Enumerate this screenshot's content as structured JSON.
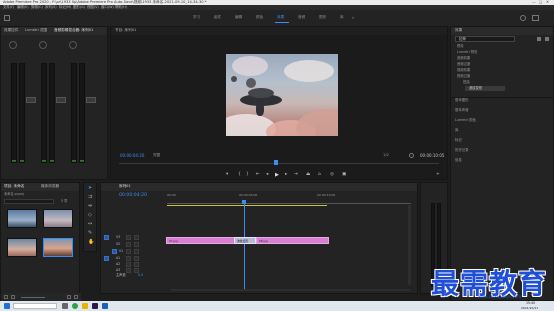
{
  "app": {
    "title": "Adobe Premiere Pro 2020 - F:\\pr\\1933 Sp\\Adobe Premiere Pro Auto-Save\\视频\\1933 未命名-2021-09-10_14-34-30 *",
    "window_controls": [
      "—",
      "□",
      "✕"
    ]
  },
  "menu": [
    "文件(F)",
    "编辑(E)",
    "剪辑(C)",
    "序列(S)",
    "标记(M)",
    "图形(G)",
    "视图(V)",
    "窗口(W)",
    "帮助(H)"
  ],
  "workspaces": [
    {
      "label": "学习",
      "active": false
    },
    {
      "label": "组件",
      "active": false
    },
    {
      "label": "编辑",
      "active": false
    },
    {
      "label": "颜色",
      "active": false
    },
    {
      "label": "效果",
      "active": true
    },
    {
      "label": "音频",
      "active": false
    },
    {
      "label": "图形",
      "active": false
    },
    {
      "label": "库",
      "active": false
    }
  ],
  "left_panel": {
    "title": "音频剪辑混合器: 序列01",
    "tabs": [
      "效果控件",
      "Lumetri 范围",
      "源: (无剪辑)",
      "音频剪辑混合器: 序列01"
    ]
  },
  "program_monitor": {
    "title": "节目: 序列01",
    "timecode_left": "00:00:04:20",
    "zoom": "完整",
    "quality": "1/2",
    "timecode_right": "00:00:10:05"
  },
  "effects_panel": {
    "title": "效果",
    "search_placeholder": "拉伸",
    "tree": [
      "预设",
      "Lumetri 预设",
      "音频效果",
      "音频过渡",
      "视频效果",
      "视频过渡",
      "扭曲",
      "波纹变形"
    ],
    "sections": [
      "基本图形",
      "基本声音",
      "Lumetri 颜色",
      "库",
      "标记",
      "历史记录",
      "信息"
    ]
  },
  "project_panel": {
    "title": "项目: 未命名",
    "tab2": "媒体浏览器",
    "path": "未命名.prproj",
    "item_count": "5 项"
  },
  "timeline": {
    "title": "序列01",
    "timecode": "00:00:04:20",
    "ruler_labels": [
      "00:00",
      "00:00:05:00",
      "00:00:10:00"
    ],
    "video_tracks": [
      "V3",
      "V2",
      "V1"
    ],
    "audio_tracks": [
      "A1",
      "A2",
      "A3"
    ],
    "master": "主声道",
    "master_value": "0.0",
    "clip_a": "07.jpg",
    "clip_b": "08.jpg",
    "transition": "波纹变形"
  },
  "taskbar": {
    "time": "15:40",
    "date": "2021/10/11"
  },
  "watermark": {
    "text": "最需教育",
    "url": "www.zuixujiaoyu.com"
  },
  "colors": {
    "accent": "#3c8df0",
    "clip": "#d77fd0",
    "playhead": "#3c8df0",
    "watermark": "#1f4fd8"
  }
}
